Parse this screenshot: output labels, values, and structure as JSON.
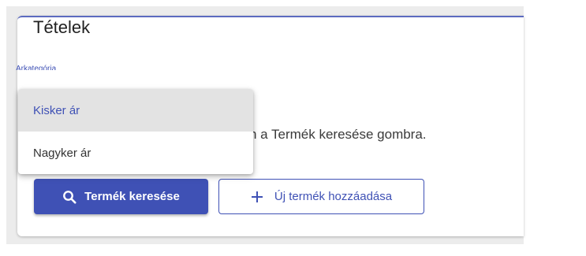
{
  "card": {
    "title": "Tételek",
    "field_label": "Árkategória",
    "hint": "son a Termék keresése gombra."
  },
  "dropdown": {
    "options": [
      {
        "label": "Kisker ár",
        "selected": true
      },
      {
        "label": "Nagyker ár",
        "selected": false
      }
    ]
  },
  "buttons": {
    "search_label": "Termék keresése",
    "add_label": "Új termék hozzáadása"
  },
  "icons": {
    "search": "search-icon",
    "add": "plus-icon"
  },
  "colors": {
    "primary": "#3f51b5",
    "selected_bg": "#e3e3e3"
  }
}
